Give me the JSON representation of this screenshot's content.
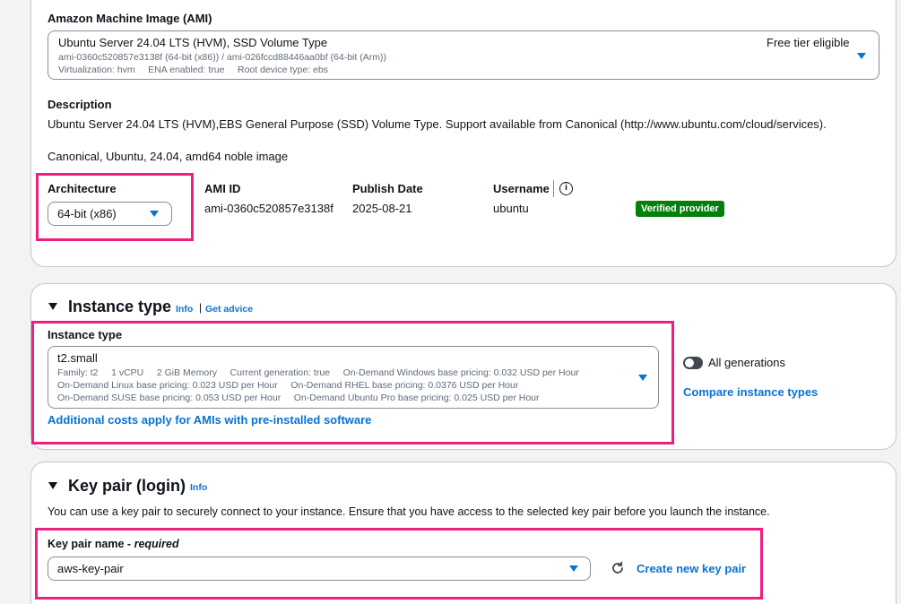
{
  "ami": {
    "heading": "Amazon Machine Image (AMI)",
    "selected_name": "Ubuntu Server 24.04 LTS (HVM), SSD Volume Type",
    "selected_ids": "ami-0360c520857e3138f (64-bit (x86)) / ami-026fccd88446aa0bf (64-bit (Arm))",
    "selected_meta": "Virtualization: hvm     ENA enabled: true     Root device type: ebs",
    "free_tier": "Free tier eligible",
    "description_heading": "Description",
    "description_text": "Ubuntu Server 24.04 LTS (HVM),EBS General Purpose (SSD) Volume Type. Support available from Canonical (http://www.ubuntu.com/cloud/services).",
    "tags_text": "Canonical, Ubuntu, 24.04, amd64 noble image",
    "architecture_label": "Architecture",
    "architecture_value": "64-bit (x86)",
    "ami_id_label": "AMI ID",
    "ami_id_value": "ami-0360c520857e3138f",
    "publish_date_label": "Publish Date",
    "publish_date_value": "2025-08-21",
    "username_label": "Username",
    "username_value": "ubuntu",
    "verified_badge": "Verified provider",
    "info_icon": "i"
  },
  "instance_type": {
    "section_title": "Instance type",
    "info_link": "Info",
    "separator": "|",
    "advice_link": "Get advice",
    "field_label": "Instance type",
    "selected_value": "t2.small",
    "detail_line1": "Family: t2     1 vCPU     2 GiB Memory     Current generation: true     On-Demand Windows base pricing: 0.032 USD per Hour",
    "detail_line2": "On-Demand Linux base pricing: 0.023 USD per Hour     On-Demand RHEL base pricing: 0.0376 USD per Hour",
    "detail_line3": "On-Demand SUSE base pricing: 0.053 USD per Hour     On-Demand Ubuntu Pro base pricing: 0.025 USD per Hour",
    "additional_costs_link": "Additional costs apply for AMIs with pre-installed software",
    "all_generations_label": "All generations",
    "all_generations_enabled": false,
    "compare_link": "Compare instance types"
  },
  "key_pair": {
    "section_title": "Key pair (login)",
    "info_link": "Info",
    "description": "You can use a key pair to securely connect to your instance. Ensure that you have access to the selected key pair before you launch the instance.",
    "field_label": "Key pair name - ",
    "field_required": "required",
    "selected_value": "aws-key-pair",
    "create_link": "Create new key pair"
  },
  "colors": {
    "highlight": "#ed1f7f",
    "link": "#0972d3",
    "badge": "#037f0c"
  }
}
